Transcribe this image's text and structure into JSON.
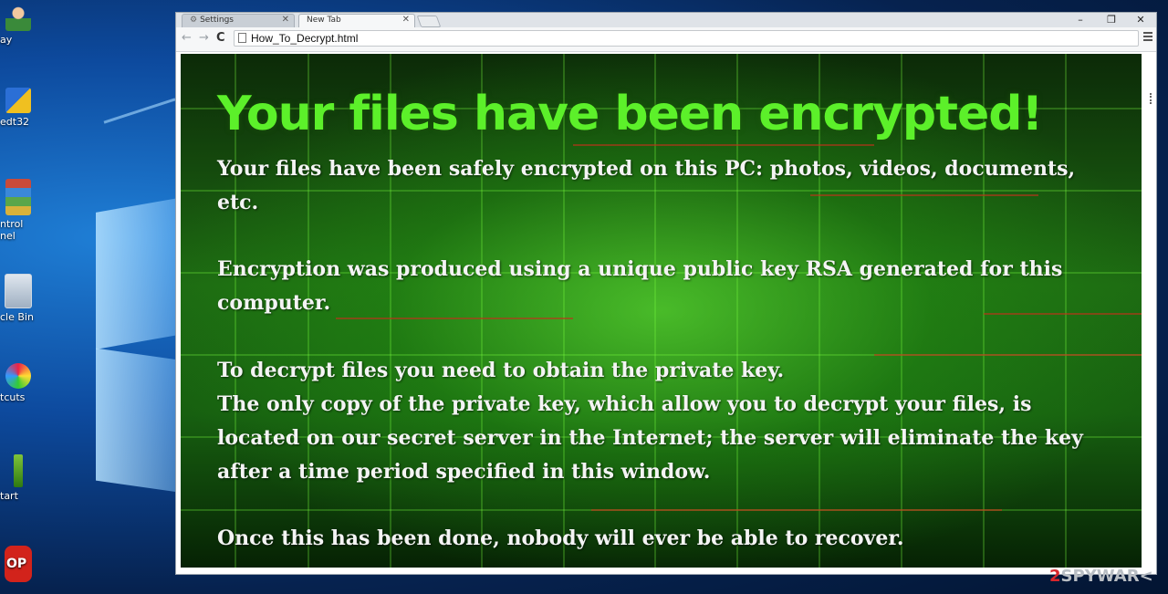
{
  "desktop": {
    "icons": [
      {
        "label": "ay",
        "icon": "user-icon"
      },
      {
        "label": "edt32",
        "icon": "regedit-icon"
      },
      {
        "label": "ntrol",
        "label2": "nel",
        "icon": "control-panel-icon"
      },
      {
        "label": "cle Bin",
        "icon": "recycle-bin-icon"
      },
      {
        "label": "tcuts",
        "icon": "shortcuts-icon"
      },
      {
        "label": "tart",
        "icon": "start-arrow-icon"
      },
      {
        "label": "OP",
        "icon": "stop-sign-icon"
      }
    ]
  },
  "browser": {
    "tabs": [
      {
        "label": "Settings",
        "icon": "gear-icon",
        "active": false
      },
      {
        "label": "New Tab",
        "active": true
      }
    ],
    "address": "How_To_Decrypt.html",
    "window_controls": {
      "minimize": "–",
      "maximize": "❐",
      "close": "✕"
    }
  },
  "ransom_note": {
    "headline": "Your files have been encrypted!",
    "headline_color": "#5cf02a",
    "paragraphs": [
      "Your files have been safely encrypted on this PC: photos, videos, documents, etc.",
      "Encryption was produced using a unique public key RSA generated for this computer.",
      "To decrypt files you need to obtain the private key.",
      "The only copy of the private key, which allow you to decrypt your files, is located on our secret server in the Internet; the server will eliminate the key after a time period specified in this window.",
      "Once this has been done, nobody will ever be able to recover."
    ]
  },
  "watermark": {
    "prefix": "2",
    "middle": "SPYWAR",
    "suffix": "<"
  }
}
